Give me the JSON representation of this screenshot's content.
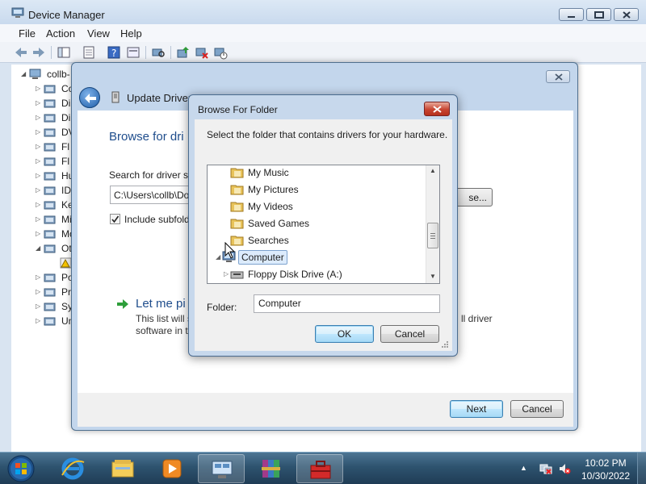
{
  "device_manager": {
    "title": "Device Manager",
    "menu": [
      "File",
      "Action",
      "View",
      "Help"
    ],
    "toolbar_icons": [
      "back-icon",
      "forward-icon",
      "show-hide-tree-icon",
      "properties-icon",
      "help-icon",
      "view-icon",
      "scan-hardware-icon",
      "update-driver-icon",
      "uninstall-icon",
      "disable-icon"
    ],
    "tree": {
      "root": "collb-",
      "items": [
        "Co",
        "Di",
        "Di",
        "DV",
        "Fl",
        "Fl",
        "Hu",
        "ID",
        "Ke",
        "Mi",
        "Mo",
        "Ot",
        "",
        "Po",
        "Pr",
        "Sy",
        "Un"
      ]
    }
  },
  "wizard": {
    "title": "Update Driver S",
    "heading": "Browse for dri",
    "search_label": "Search for driver so",
    "path_value": "C:\\Users\\collb\\Do",
    "browse_label": "se...",
    "include_subfolders_label": "Include subfold",
    "include_subfolders_checked": true,
    "let_me_pick": "Let me pi",
    "desc_line1": "This list will s",
    "desc_line1_tail": "ll driver",
    "desc_line2": "software in t",
    "next_label": "Next",
    "cancel_label": "Cancel"
  },
  "browse_folder": {
    "title": "Browse For Folder",
    "instruction": "Select the folder that contains drivers for your hardware.",
    "folders": [
      {
        "label": "My Music",
        "icon": "music-folder-icon"
      },
      {
        "label": "My Pictures",
        "icon": "pictures-folder-icon"
      },
      {
        "label": "My Videos",
        "icon": "videos-folder-icon"
      },
      {
        "label": "Saved Games",
        "icon": "saved-games-folder-icon"
      },
      {
        "label": "Searches",
        "icon": "searches-folder-icon"
      },
      {
        "label": "Computer",
        "icon": "computer-icon",
        "selected": true
      },
      {
        "label": "Floppy Disk Drive (A:)",
        "icon": "floppy-drive-icon"
      }
    ],
    "folder_label": "Folder:",
    "folder_value": "Computer",
    "ok_label": "OK",
    "cancel_label": "Cancel"
  },
  "taskbar": {
    "time": "10:02 PM",
    "date": "10/30/2022",
    "apps": [
      "explorer-icon",
      "media-player-icon",
      "device-manager-icon",
      "winrar-icon",
      "toolbox-icon"
    ]
  }
}
